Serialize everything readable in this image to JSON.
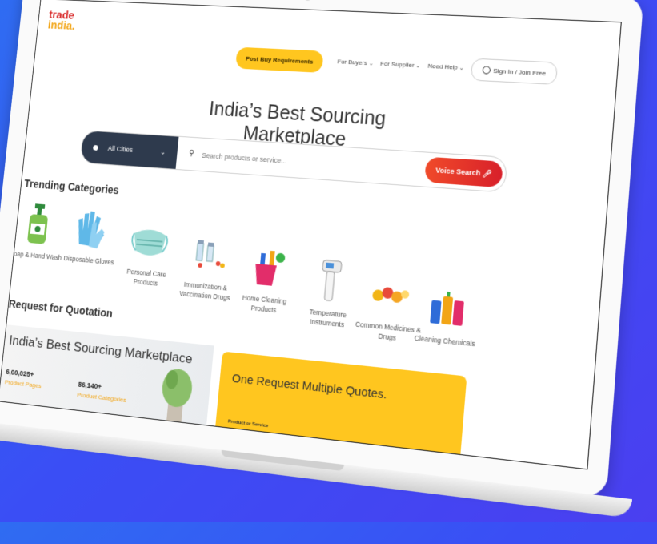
{
  "brand": {
    "line1": "trade",
    "line2": "india."
  },
  "header": {
    "post_button": "Post Buy Requirements",
    "nav": [
      "For Buyers",
      "For Supplier",
      "Need Help"
    ],
    "signin": "Sign In / Join Free"
  },
  "hero": {
    "title": "India’s Best Sourcing Marketplace"
  },
  "search": {
    "city": "All Cities",
    "placeholder": "Search products or service...",
    "voice_button": "Voice Search"
  },
  "trending": {
    "title": "Trending Categories",
    "items": [
      {
        "label": "Soap & Hand Wash",
        "icon": "hand-wash-bottle-icon"
      },
      {
        "label": "Disposable Gloves",
        "icon": "gloves-icon"
      },
      {
        "label": "Personal Care Products",
        "icon": "face-mask-icon"
      },
      {
        "label": "Immunization & Vaccination Drugs",
        "icon": "vaccine-vials-icon"
      },
      {
        "label": "Home Cleaning Products",
        "icon": "cleaning-bucket-icon"
      },
      {
        "label": "Temperature Instruments",
        "icon": "thermometer-gun-icon"
      },
      {
        "label": "Common Medicines & Drugs",
        "icon": "medicine-pills-icon"
      },
      {
        "label": "Cleaning Chemicals",
        "icon": "chemical-bottles-icon"
      }
    ]
  },
  "rfq": {
    "title": "Request for Quotation",
    "banner_title": "India’s Best Sourcing Marketplace",
    "stats": [
      {
        "value": "6,00,025+",
        "label": "Product Pages"
      },
      {
        "value": "86,140+",
        "label": "Product Categories"
      }
    ],
    "card_title": "One Request Multiple Quotes.",
    "card_field": "Product or Service"
  },
  "colors": {
    "accent_yellow": "#ffc61f",
    "voice_red": "#d8202a",
    "dark_navy": "#2e3a4d",
    "background_blue": "#3a4ef5"
  }
}
